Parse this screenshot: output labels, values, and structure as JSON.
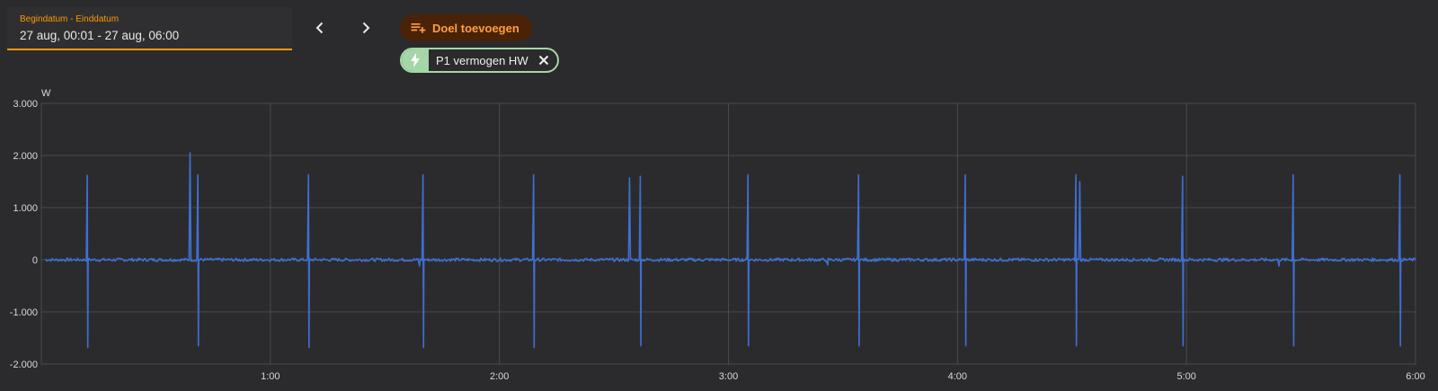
{
  "date_range": {
    "label": "Begindatum - Einddatum",
    "value": "27 aug, 00:01 - 27 aug, 06:00"
  },
  "nav": {
    "prev_icon": "chevron-left-icon",
    "next_icon": "chevron-right-icon"
  },
  "add_target": {
    "label": "Doel toevoegen",
    "icon": "playlist-plus-icon"
  },
  "chip": {
    "label": "P1 vermogen HW",
    "icon": "lightning-bolt-icon",
    "close_icon": "close-icon"
  },
  "colors": {
    "accent": "#ff9800",
    "series": "#3f6fd1",
    "chip": "#a5d6a7",
    "background": "#2b2b2d",
    "grid": "#4a4a4c"
  },
  "chart_data": {
    "type": "line",
    "unit": "W",
    "ylim": [
      -2000,
      3000
    ],
    "y_ticks": [
      -2000,
      -1000,
      0,
      1000,
      2000,
      3000
    ],
    "y_tick_labels": [
      "-2.000",
      "-1.000",
      "0",
      "1.000",
      "2.000",
      "3.000"
    ],
    "xlim": [
      "00:01",
      "06:00"
    ],
    "x_ticks": [
      "1:00",
      "2:00",
      "3:00",
      "4:00",
      "5:00",
      "6:00"
    ],
    "grid": true,
    "series": [
      {
        "baseline": 0,
        "spikes": [
          {
            "t": "00:12",
            "up": 1620,
            "down": -1680
          },
          {
            "t": "00:39",
            "up": 2050,
            "down": 0
          },
          {
            "t": "00:41",
            "up": 1630,
            "down": -1650
          },
          {
            "t": "01:10",
            "up": 1630,
            "down": -1680
          },
          {
            "t": "01:39",
            "up": 0,
            "down": -120
          },
          {
            "t": "01:40",
            "up": 1630,
            "down": -1680
          },
          {
            "t": "02:09",
            "up": 1630,
            "down": -1680
          },
          {
            "t": "02:34",
            "up": 1570,
            "down": 0
          },
          {
            "t": "02:37",
            "up": 1600,
            "down": -1650
          },
          {
            "t": "03:05",
            "up": 1630,
            "down": -1650
          },
          {
            "t": "03:26",
            "up": 0,
            "down": -100
          },
          {
            "t": "03:34",
            "up": 1630,
            "down": -1650
          },
          {
            "t": "04:02",
            "up": 1630,
            "down": -1650
          },
          {
            "t": "04:31",
            "up": 1630,
            "down": -1650
          },
          {
            "t": "04:32",
            "up": 1500,
            "down": 0
          },
          {
            "t": "04:59",
            "up": 1600,
            "down": -1650
          },
          {
            "t": "05:24",
            "up": 0,
            "down": -120
          },
          {
            "t": "05:28",
            "up": 1630,
            "down": -1650
          },
          {
            "t": "05:56",
            "up": 1630,
            "down": -1650
          }
        ]
      }
    ]
  }
}
